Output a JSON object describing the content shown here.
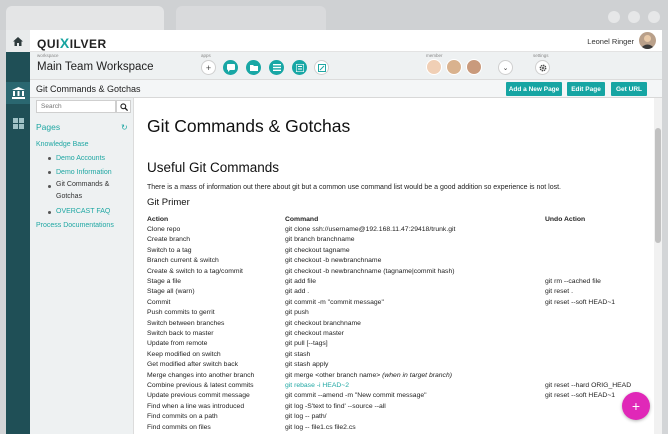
{
  "header": {
    "logo_left": "QUI",
    "logo_x": "X",
    "logo_right": "ILVER",
    "user_name": "Leonel Ringer"
  },
  "workspace": {
    "label": "workspace",
    "name": "Main Team Workspace",
    "apps_label": "apps",
    "member_label": "member",
    "settings_label": "settings"
  },
  "titlebar": {
    "page_title": "Git Commands & Gotchas",
    "add_page": "Add a New Page",
    "edit_page": "Edit Page",
    "get_url": "Get URL"
  },
  "sidebar": {
    "search_placeholder": "Search",
    "pages_label": "Pages",
    "tree": [
      {
        "label": "Knowledge Base",
        "level": 0
      },
      {
        "label": "Demo Accounts",
        "level": 1
      },
      {
        "label": "Demo Information",
        "level": 1
      },
      {
        "label": "Git Commands & Gotchas",
        "level": 1,
        "current": true
      },
      {
        "label": "OVERCAST FAQ",
        "level": 1
      },
      {
        "label": "Process Documentations",
        "level": 0
      }
    ]
  },
  "content": {
    "title": "Git Commands & Gotchas",
    "section_title": "Useful Git Commands",
    "intro": "There is a mass of information out there about git but a common use command list would be a good addition so experience is not lost.",
    "subsection_title": "Git Primer",
    "columns": [
      "Action",
      "Command",
      "Undo Action"
    ],
    "rows": [
      [
        "Clone repo",
        "git clone ssh://username@192.168.11.47:29418/trunk.git",
        ""
      ],
      [
        "Create branch",
        "git branch branchname",
        ""
      ],
      [
        "Switch to a tag",
        "git checkout tagname",
        ""
      ],
      [
        "Branch current & switch",
        "git checkout -b newbranchname",
        ""
      ],
      [
        "Create & switch to a tag/commit",
        "git checkout -b newbranchname (tagname|commit hash)",
        ""
      ],
      [
        "Stage a file",
        "git add file",
        "git rm --cached file"
      ],
      [
        "Stage all (warn)",
        "git add .",
        "git reset ."
      ],
      [
        "Commit",
        "git commit -m \"commit message\"",
        "git reset --soft HEAD~1"
      ],
      [
        "Push commits to gerrit",
        "git push",
        ""
      ],
      [
        "Switch between branches",
        "git checkout branchname",
        ""
      ],
      [
        "Switch back to master",
        "git checkout master",
        ""
      ],
      [
        "Update from remote",
        "git pull [--tags]",
        ""
      ],
      [
        "Keep modified on switch",
        "git stash",
        ""
      ],
      [
        "Get modified after switch back",
        "git stash apply",
        ""
      ],
      [
        "Merge changes into another branch",
        "git merge <other branch name>",
        ""
      ],
      [
        "Combine previous & latest commits",
        "git rebase -i HEAD~2",
        "git reset --hard ORIG_HEAD"
      ],
      [
        "Update previous commit message",
        "git commit --amend -m \"New commit message\"",
        "git reset --soft HEAD~1"
      ],
      [
        "Find when a line was introduced",
        "git log -S'text to find' --source --all",
        ""
      ],
      [
        "Find commits on a path",
        "git log -- path/",
        ""
      ],
      [
        "Find commits on files",
        "git log -- file1.cs file2.cs",
        ""
      ]
    ],
    "merge_note": "(when in target branch)"
  }
}
